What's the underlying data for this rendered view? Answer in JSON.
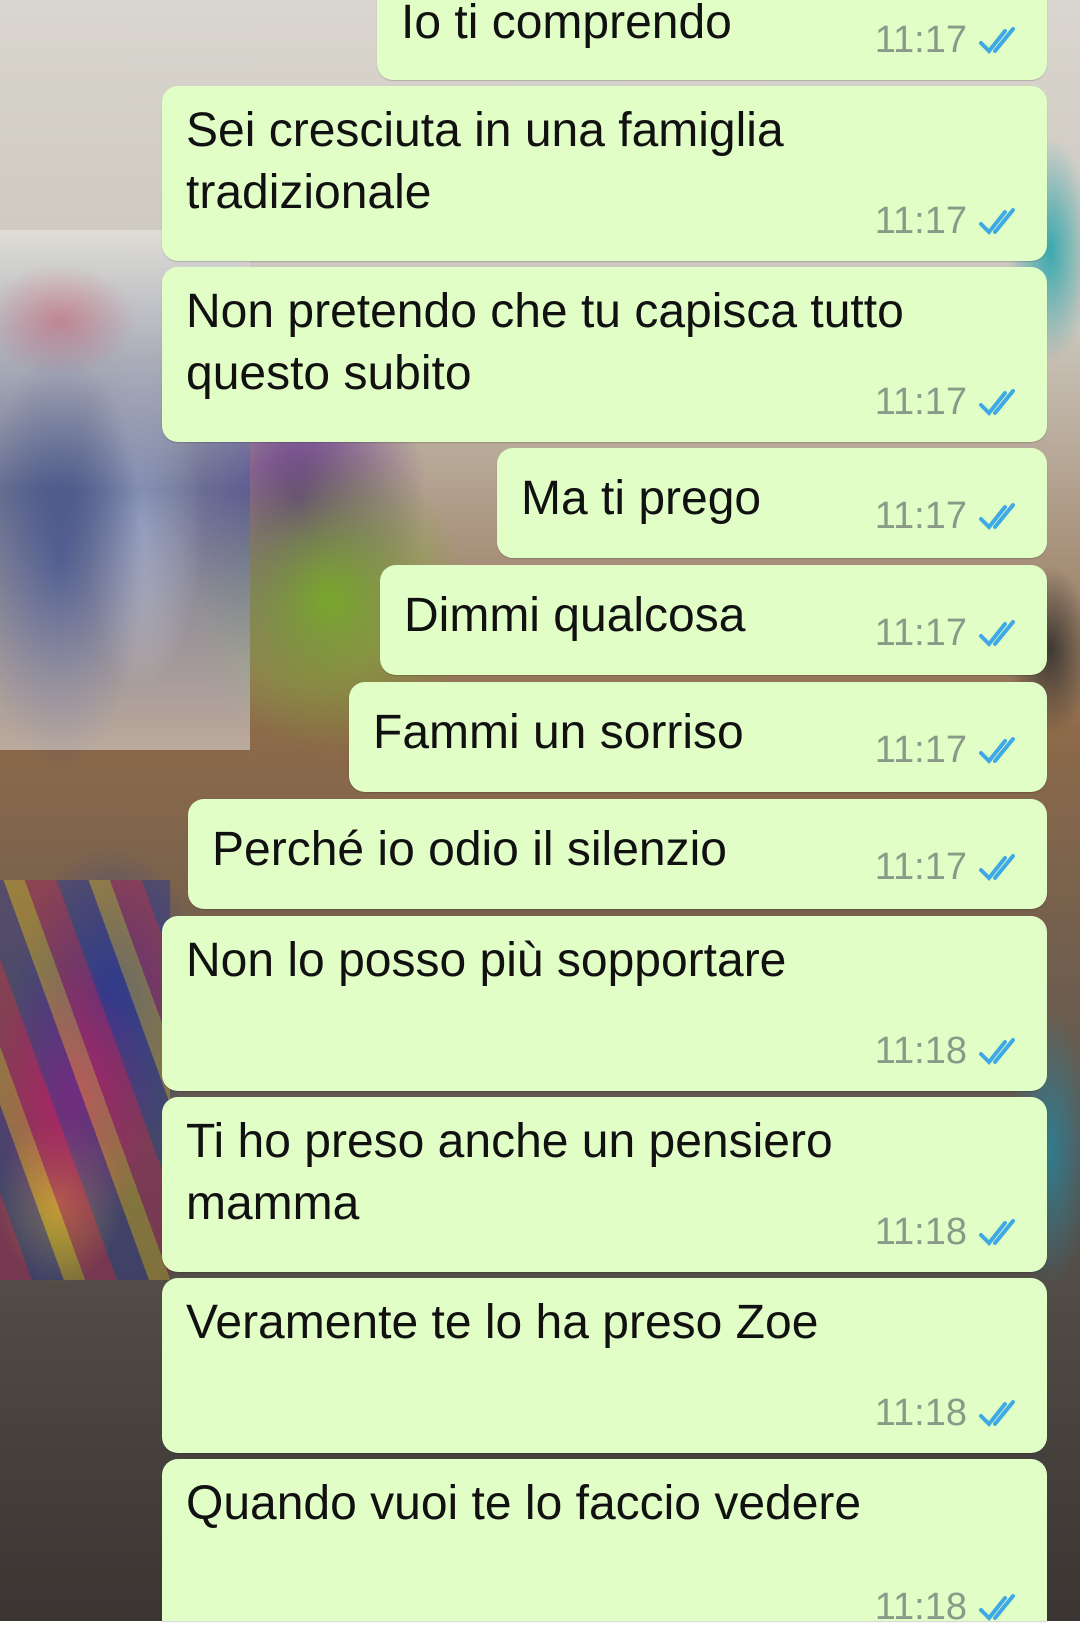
{
  "chat": {
    "messages": [
      {
        "text": "Io ti comprendo",
        "time": "11:17",
        "status_icon": "double-check-read-icon"
      },
      {
        "text": "Sei cresciuta in una famiglia\ntradizionale",
        "time": "11:17",
        "status_icon": "double-check-read-icon"
      },
      {
        "text": "Non pretendo che tu capisca tutto\nquesto subito",
        "time": "11:17",
        "status_icon": "double-check-read-icon"
      },
      {
        "text": "Ma ti prego",
        "time": "11:17",
        "status_icon": "double-check-read-icon"
      },
      {
        "text": "Dimmi qualcosa",
        "time": "11:17",
        "status_icon": "double-check-read-icon"
      },
      {
        "text": "Fammi un sorriso",
        "time": "11:17",
        "status_icon": "double-check-read-icon"
      },
      {
        "text": "Perché io odio il silenzio",
        "time": "11:17",
        "status_icon": "double-check-read-icon"
      },
      {
        "text": "Non lo posso più sopportare",
        "time": "11:18",
        "status_icon": "double-check-read-icon"
      },
      {
        "text": "Ti ho preso anche un pensiero\nmamma",
        "time": "11:18",
        "status_icon": "double-check-read-icon"
      },
      {
        "text": "Veramente te lo ha preso Zoe",
        "time": "11:18",
        "status_icon": "double-check-read-icon"
      },
      {
        "text": "Quando vuoi te lo faccio vedere",
        "time": "11:18",
        "status_icon": "double-check-read-icon"
      }
    ]
  },
  "colors": {
    "outgoing_bubble": "#e1fec6",
    "read_ticks": "#3fa9e6",
    "timestamp": "#8a9a88"
  }
}
